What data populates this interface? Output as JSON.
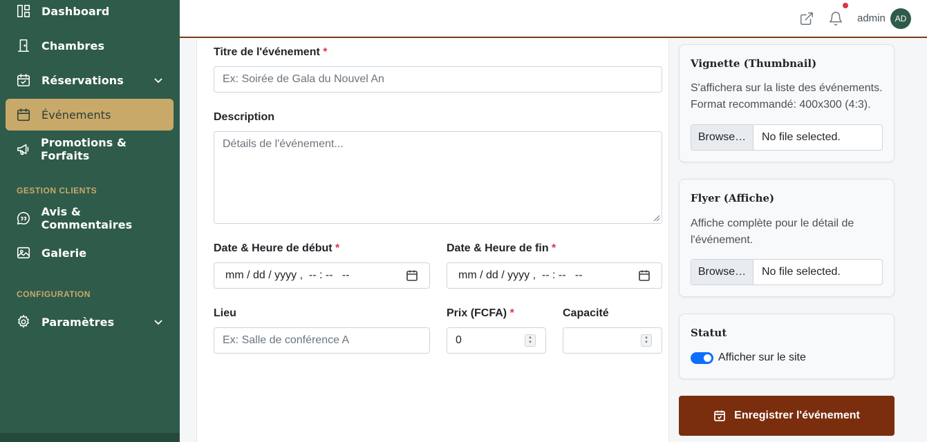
{
  "sidebar": {
    "items": [
      {
        "label": "Dashboard",
        "icon": "dashboard-icon"
      },
      {
        "label": "Chambres",
        "icon": "door-icon"
      },
      {
        "label": "Réservations",
        "icon": "calendar-check-icon"
      },
      {
        "label": "Événements",
        "icon": "calendar-icon"
      },
      {
        "label": "Promotions & Forfaits",
        "icon": "megaphone-icon"
      },
      {
        "label": "Avis & Commentaires",
        "icon": "quote-bubble-icon"
      },
      {
        "label": "Galerie",
        "icon": "image-icon"
      },
      {
        "label": "Paramètres",
        "icon": "gear-icon"
      }
    ],
    "sections": {
      "clients": "GESTION CLIENTS",
      "config": "CONFIGURATION"
    },
    "colors": {
      "background": "#2f5b4a",
      "active": "#c9a96a",
      "section": "#c9a96a"
    }
  },
  "topbar": {
    "user": "admin",
    "avatar_initials": "AD"
  },
  "form": {
    "title": {
      "label": "Titre de l'événement",
      "required": "*",
      "placeholder": "Ex: Soirée de Gala du Nouvel An"
    },
    "description": {
      "label": "Description",
      "placeholder": "Détails de l'événement..."
    },
    "start": {
      "label": "Date & Heure de début",
      "required": "*",
      "value": "mm / dd / yyyy ,  -- : --   --"
    },
    "end": {
      "label": "Date & Heure de fin",
      "required": "*",
      "value": "mm / dd / yyyy ,  -- : --   --"
    },
    "place": {
      "label": "Lieu",
      "placeholder": "Ex: Salle de conférence A"
    },
    "price": {
      "label": "Prix (FCFA)",
      "required": "*",
      "value": "0"
    },
    "capacity": {
      "label": "Capacité",
      "value": ""
    }
  },
  "thumbnail": {
    "title": "Vignette (Thumbnail)",
    "desc": "S'affichera sur la liste des événements. Format recommandé: 400x300 (4:3).",
    "browse": "Browse…",
    "file": "No file selected."
  },
  "flyer": {
    "title": "Flyer (Affiche)",
    "desc": "Affiche complète pour le détail de l'événement.",
    "browse": "Browse…",
    "file": "No file selected."
  },
  "status": {
    "title": "Statut",
    "toggle_label": "Afficher sur le site",
    "toggle_on": true
  },
  "save": {
    "label": "Enregistrer l'événement"
  },
  "colors": {
    "primary_button": "#7a2e0e",
    "toggle": "#0d6efd",
    "required": "#dc3545"
  }
}
